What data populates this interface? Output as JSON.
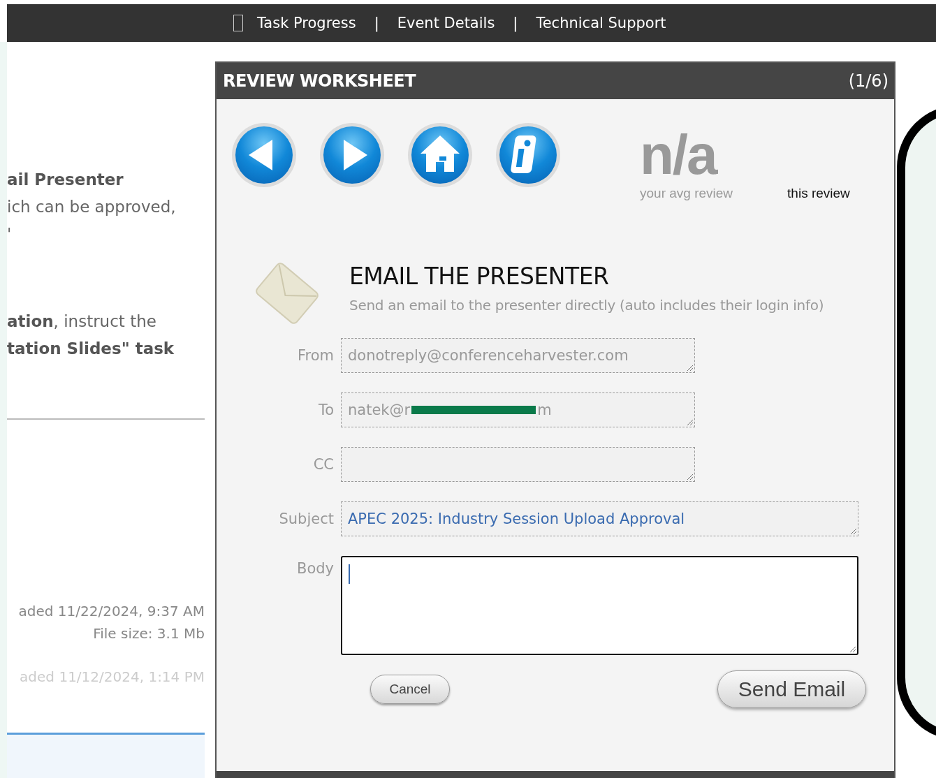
{
  "top_nav": {
    "links": [
      {
        "label": "Task Progress"
      },
      {
        "label": "Event Details"
      },
      {
        "label": "Technical Support"
      }
    ],
    "separator": "|"
  },
  "background_page": {
    "paragraphs": [
      [
        {
          "text": "ail Presenter",
          "kind": "heading"
        },
        {
          "text": "ich can be approved,",
          "kind": "body"
        },
        {
          "text": "'",
          "kind": "body"
        }
      ],
      [
        {
          "text": "**ation**, instruct the",
          "kind": "body"
        },
        {
          "text": "tation Slides\" task",
          "kind": "heading"
        }
      ]
    ],
    "uploads": [
      {
        "uploaded": "aded 11/22/2024, 9:37 AM",
        "size": "File size: 3.1 Mb",
        "disabled": false
      },
      {
        "uploaded": "aded 11/12/2024, 1:14 PM",
        "disabled": true
      }
    ]
  },
  "dialog": {
    "title": "REVIEW WORKSHEET",
    "counter": "(1/6)",
    "nav_buttons": [
      {
        "kind": "back"
      },
      {
        "kind": "forward"
      },
      {
        "kind": "home"
      },
      {
        "kind": "info"
      }
    ],
    "avg_review": {
      "value": "n/a",
      "label": "your avg review"
    },
    "this_review": {
      "label": "this review"
    },
    "heading": "EMAIL THE PRESENTER",
    "subheading": "Send an email to the presenter directly (auto includes their login info)",
    "fields": [
      {
        "label": "From",
        "kind": "short",
        "value": "donotreply@conferenceharvester.com",
        "disabled": true,
        "focused": false
      },
      {
        "label": "To",
        "kind": "short",
        "value": "natek@r",
        "value_end": "m",
        "redacted": true,
        "disabled": true,
        "focused": false
      },
      {
        "label": "CC",
        "kind": "short",
        "focused": false
      },
      {
        "label": "Subject",
        "kind": "wide",
        "value": "APEC 2025: Industry Session Upload Approval",
        "disabled": false,
        "focused": false
      },
      {
        "label": "Body",
        "kind": "body",
        "disabled": false,
        "focused": true
      }
    ],
    "cancel": "Cancel",
    "send": "Send Email"
  }
}
